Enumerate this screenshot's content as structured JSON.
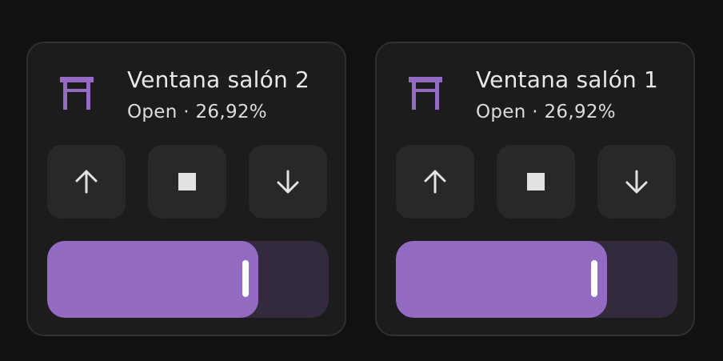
{
  "accent_color": "#936bc3",
  "cards": [
    {
      "title": "Ventana salón 2",
      "state": "Open · 26,92%",
      "icon": "window-shutter-icon",
      "controls": [
        "arrow-up-icon",
        "stop-icon",
        "arrow-down-icon"
      ],
      "slider_fill_percent": 75
    },
    {
      "title": "Ventana salón 1",
      "state": "Open · 26,92%",
      "icon": "window-shutter-icon",
      "controls": [
        "arrow-up-icon",
        "stop-icon",
        "arrow-down-icon"
      ],
      "slider_fill_percent": 75
    }
  ]
}
